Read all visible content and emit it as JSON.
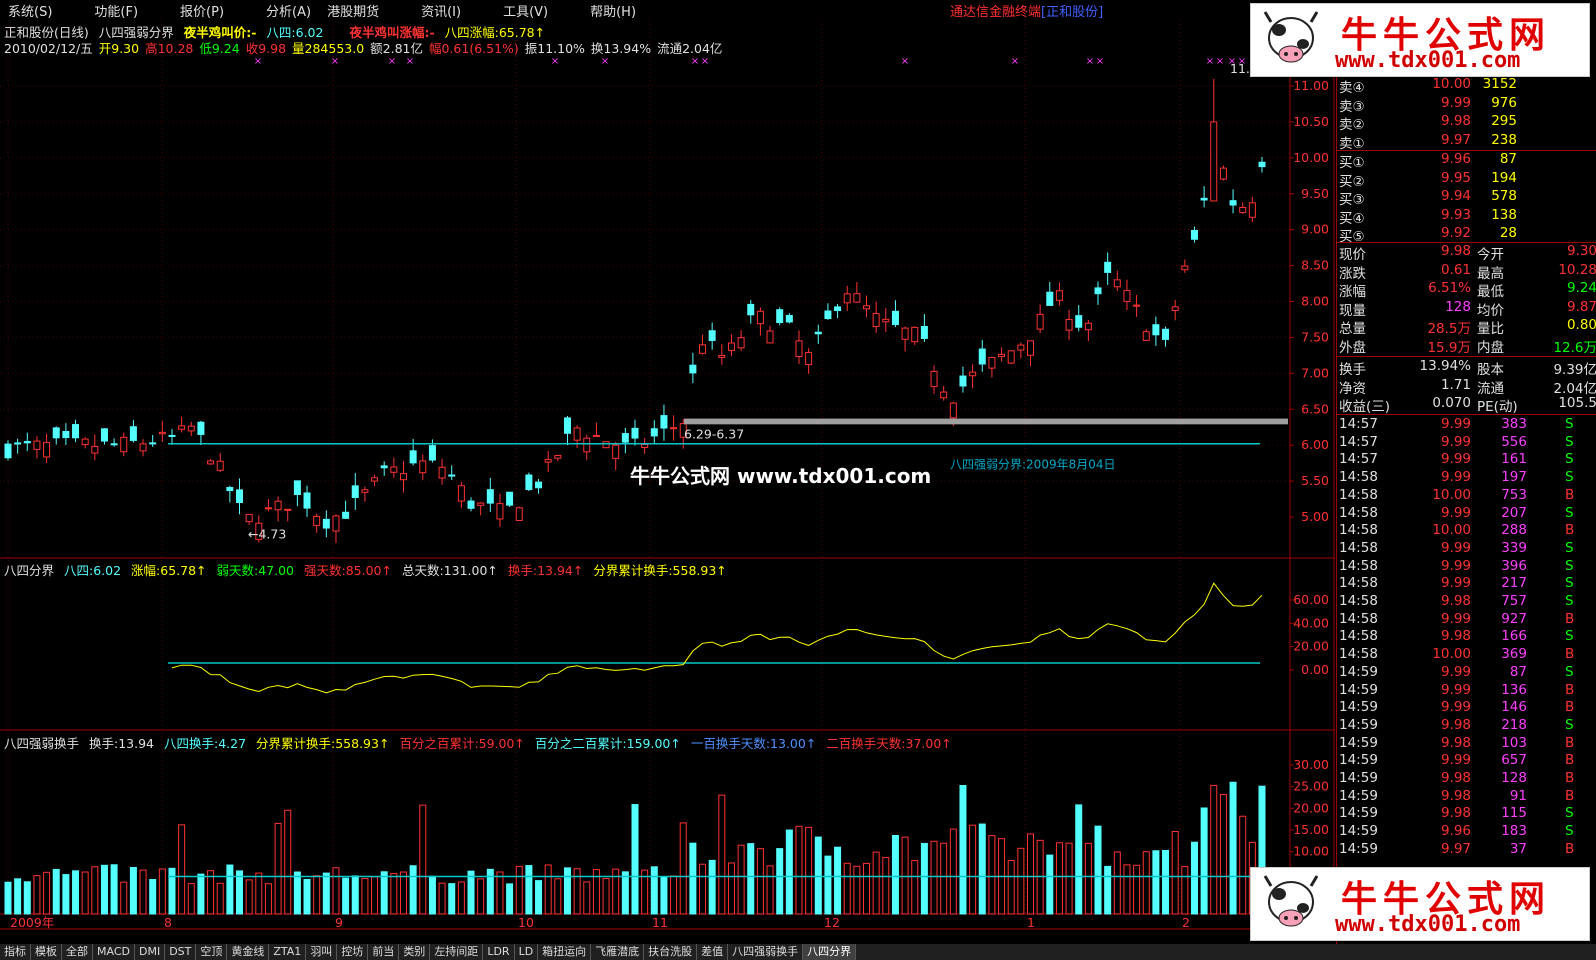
{
  "menu": {
    "items": [
      "系统(S)",
      "功能(F)",
      "报价(P)",
      "分析(A)",
      "港股期货",
      "资讯(I)",
      "工具(V)",
      "帮助(H)"
    ],
    "brand": "通达信金融终端",
    "brand_company": "[正和股份]"
  },
  "header": {
    "stock": "正和股份(日线)",
    "indicator": "八四强弱分界",
    "midnight_price": "夜半鸡叫价:-",
    "ba_si": "八四:6.02",
    "midnight_rise": "夜半鸡叫涨幅:-",
    "ba_si_rise": "八四涨幅:65.78↑",
    "date": "2010/02/12/五",
    "open": "开9.30",
    "high": "高10.28",
    "low": "低9.24",
    "close": "收9.98",
    "volume": "量284553.0",
    "amount": "额2.81亿",
    "change": "幅0.61(6.51%)",
    "amplitude": "振11.10%",
    "turnover": "换13.94%",
    "float": "流通2.04亿"
  },
  "main_chart": {
    "y_ticks": [
      "11.00",
      "10.50",
      "10.00",
      "9.50",
      "9.00",
      "8.50",
      "8.00",
      "7.50",
      "7.00",
      "6.50",
      "6.00",
      "5.50",
      "5.00"
    ],
    "low_label": "←4.73",
    "high_label": "11.",
    "range_label": "6.29-6.37",
    "divider_label": "八四强弱分界:2009年8月04日",
    "ba_si_level": 6.02
  },
  "sub1": {
    "title": "八四分界",
    "ba_si": "八四:6.02",
    "rise": "涨幅:65.78↑",
    "weak_days": "弱天数:47.00",
    "strong_days": "强天数:85.00↑",
    "total_days": "总天数:131.00↑",
    "turnover": "换手:13.94↑",
    "cum_turnover": "分界累计换手:558.93↑",
    "y_ticks": [
      "60.00",
      "40.00",
      "20.00",
      "0.00"
    ]
  },
  "sub2": {
    "title": "八四强弱换手",
    "turnover": "换手:13.94",
    "ba_si_turnover": "八四换手:4.27",
    "cum_turnover": "分界累计换手:558.93↑",
    "pct100": "百分之百累计:59.00↑",
    "pct200": "百分之二百累计:159.00↑",
    "days100": "一百换手天数:13.00↑",
    "days200": "二百换手天数:37.00↑",
    "y_ticks": [
      "30.00",
      "25.00",
      "20.00",
      "15.00",
      "10.00"
    ]
  },
  "x_axis": {
    "labels": [
      "2009年",
      "8",
      "9",
      "10",
      "11",
      "12",
      "1",
      "2"
    ]
  },
  "order_book": {
    "sells": [
      {
        "label": "卖④",
        "price": "10.00",
        "vol": "3152"
      },
      {
        "label": "卖③",
        "price": "9.99",
        "vol": "976"
      },
      {
        "label": "卖②",
        "price": "9.98",
        "vol": "295"
      },
      {
        "label": "卖①",
        "price": "9.97",
        "vol": "238"
      }
    ],
    "buys": [
      {
        "label": "买①",
        "price": "9.96",
        "vol": "87"
      },
      {
        "label": "买②",
        "price": "9.95",
        "vol": "194"
      },
      {
        "label": "买③",
        "price": "9.94",
        "vol": "578"
      },
      {
        "label": "买④",
        "price": "9.93",
        "vol": "138"
      },
      {
        "label": "买⑤",
        "price": "9.92",
        "vol": "28"
      }
    ]
  },
  "quote": [
    {
      "l1": "现价",
      "v1": "9.98",
      "l2": "今开",
      "v2": "9.30"
    },
    {
      "l1": "涨跌",
      "v1": "0.61",
      "l2": "最高",
      "v2": "10.28"
    },
    {
      "l1": "涨幅",
      "v1": "6.51%",
      "l2": "最低",
      "v2": "9.24"
    },
    {
      "l1": "现量",
      "v1": "128",
      "l2": "均价",
      "v2": "9.87"
    },
    {
      "l1": "总量",
      "v1": "28.5万",
      "l2": "量比",
      "v2": "0.80"
    },
    {
      "l1": "外盘",
      "v1": "15.9万",
      "l2": "内盘",
      "v2": "12.6万"
    }
  ],
  "fundamentals": [
    {
      "l1": "换手",
      "v1": "13.94%",
      "l2": "股本",
      "v2": "9.39亿"
    },
    {
      "l1": "净资",
      "v1": "1.71",
      "l2": "流通",
      "v2": "2.04亿"
    },
    {
      "l1": "收益(三)",
      "v1": "0.070",
      "l2": "PE(动)",
      "v2": "105.5"
    }
  ],
  "ticks": [
    {
      "t": "14:57",
      "p": "9.99",
      "v": "383",
      "s": "S"
    },
    {
      "t": "14:57",
      "p": "9.99",
      "v": "556",
      "s": "S"
    },
    {
      "t": "14:57",
      "p": "9.99",
      "v": "161",
      "s": "S"
    },
    {
      "t": "14:58",
      "p": "9.99",
      "v": "197",
      "s": "S"
    },
    {
      "t": "14:58",
      "p": "10.00",
      "v": "753",
      "s": "B"
    },
    {
      "t": "14:58",
      "p": "9.99",
      "v": "207",
      "s": "S"
    },
    {
      "t": "14:58",
      "p": "10.00",
      "v": "288",
      "s": "B"
    },
    {
      "t": "14:58",
      "p": "9.99",
      "v": "339",
      "s": "S"
    },
    {
      "t": "14:58",
      "p": "9.99",
      "v": "396",
      "s": "S"
    },
    {
      "t": "14:58",
      "p": "9.99",
      "v": "217",
      "s": "S"
    },
    {
      "t": "14:58",
      "p": "9.98",
      "v": "757",
      "s": "S"
    },
    {
      "t": "14:58",
      "p": "9.99",
      "v": "927",
      "s": "B"
    },
    {
      "t": "14:58",
      "p": "9.98",
      "v": "166",
      "s": "S"
    },
    {
      "t": "14:58",
      "p": "10.00",
      "v": "369",
      "s": "B"
    },
    {
      "t": "14:59",
      "p": "9.99",
      "v": "87",
      "s": "S"
    },
    {
      "t": "14:59",
      "p": "9.99",
      "v": "136",
      "s": "B"
    },
    {
      "t": "14:59",
      "p": "9.99",
      "v": "146",
      "s": "B"
    },
    {
      "t": "14:59",
      "p": "9.98",
      "v": "218",
      "s": "S"
    },
    {
      "t": "14:59",
      "p": "9.98",
      "v": "103",
      "s": "B"
    },
    {
      "t": "14:59",
      "p": "9.99",
      "v": "657",
      "s": "B"
    },
    {
      "t": "14:59",
      "p": "9.98",
      "v": "128",
      "s": "B"
    },
    {
      "t": "14:59",
      "p": "9.98",
      "v": "91",
      "s": "B"
    },
    {
      "t": "14:59",
      "p": "9.98",
      "v": "115",
      "s": "S"
    },
    {
      "t": "14:59",
      "p": "9.96",
      "v": "183",
      "s": "S"
    },
    {
      "t": "14:59",
      "p": "9.97",
      "v": "37",
      "s": "B"
    }
  ],
  "tabs": [
    "指标",
    "模板",
    "全部",
    "MACD",
    "DMI",
    "DST",
    "空顶",
    "黄金线",
    "ZTA1",
    "羽叫",
    "控坊",
    "前当",
    "类别",
    "左持间距",
    "LDR",
    "LD",
    "箱扭运向",
    "飞雁潜底",
    "扶台洗股",
    "差值",
    "八四强弱换手",
    "八四分界"
  ],
  "watermark": "牛牛公式网 www.tdx001.com",
  "logo": {
    "title": "牛牛公式网",
    "url": "www.tdx001.com"
  },
  "colors": {
    "up": "#ff3232",
    "down": "#54ffff",
    "cyan_line": "#00c8c8",
    "yellow": "#ffff00",
    "frame": "#a00000"
  }
}
